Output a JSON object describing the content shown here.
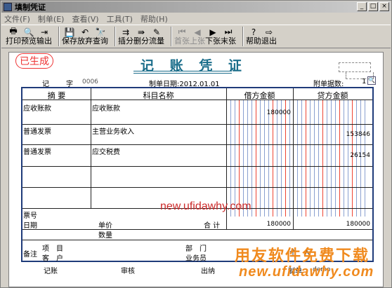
{
  "window": {
    "title": "填制凭证"
  },
  "menu": [
    "文件(F)",
    "制单(E)",
    "查看(V)",
    "工具(T)",
    "帮助(H)"
  ],
  "toolbar": [
    {
      "label": "打印",
      "icon": "🖶",
      "icon_name": "printer-icon",
      "disabled": false
    },
    {
      "label": "预览",
      "icon": "🔍",
      "icon_name": "preview-icon",
      "disabled": false
    },
    {
      "label": "输出",
      "icon": "⇥",
      "icon_name": "export-icon",
      "disabled": false
    },
    {
      "label": "保存",
      "icon": "💾",
      "icon_name": "save-icon",
      "disabled": false
    },
    {
      "label": "放弃",
      "icon": "↶",
      "icon_name": "undo-icon",
      "disabled": false
    },
    {
      "label": "查询",
      "icon": "🔭",
      "icon_name": "binoculars-icon",
      "disabled": false
    },
    {
      "label": "插分",
      "icon": "⇉",
      "icon_name": "insert-line-icon",
      "disabled": false
    },
    {
      "label": "删分",
      "icon": "⇛",
      "icon_name": "delete-line-icon",
      "disabled": false
    },
    {
      "label": "流量",
      "icon": "✎",
      "icon_name": "cashflow-icon",
      "disabled": false
    },
    {
      "label": "首张",
      "icon": "⏮",
      "icon_name": "first-icon",
      "disabled": true
    },
    {
      "label": "上张",
      "icon": "◀",
      "icon_name": "previous-icon",
      "disabled": true
    },
    {
      "label": "下张",
      "icon": "▶",
      "icon_name": "next-icon",
      "disabled": false
    },
    {
      "label": "末张",
      "icon": "⏭",
      "icon_name": "last-icon",
      "disabled": false
    },
    {
      "label": "帮助",
      "icon": "?",
      "icon_name": "help-icon",
      "disabled": false
    },
    {
      "label": "退出",
      "icon": "⇨",
      "icon_name": "exit-icon",
      "disabled": false
    }
  ],
  "voucher": {
    "stamp": "已生成",
    "title": "记 账 凭 证",
    "type_label": "记",
    "no_label": "字",
    "no_value": "0006",
    "date_label": "制单日期:2012.01.01",
    "attach_label": "附单据数:",
    "attach_value": "1",
    "col_summary": "摘 要",
    "col_account": "科目名称",
    "col_debit": "借方金额",
    "col_credit": "贷方金额",
    "rows": [
      {
        "summary": "应收账款",
        "account": "应收账款",
        "debit": "180000",
        "credit": ""
      },
      {
        "summary": "普通发票",
        "account": "主营业务收入",
        "debit": "",
        "credit": "153846"
      },
      {
        "summary": "普通发票",
        "account": "应交税费",
        "debit": "",
        "credit": "26154"
      }
    ],
    "ticket_label": "票号",
    "date_field_label": "日期",
    "price_label": "单价",
    "qty_label": "数量",
    "total_label": "合 计",
    "total_debit": "180000",
    "total_credit": "180000",
    "remark_label": "备注",
    "project_label": "项　目",
    "customer_label": "客　户",
    "dept_label": "部　门",
    "salesman_label": "业务员",
    "personal_label": "个　人",
    "bookkeeper_label": "记账",
    "auditor_label": "审核",
    "cashier_label": "出纳",
    "maker_label": "制单",
    "maker_value": "demo"
  },
  "watermarks": {
    "url_red": "new.ufidawhy.com",
    "cn_orange": "用友软件免费下载",
    "url_orange": "new.ufidawhy.com"
  }
}
